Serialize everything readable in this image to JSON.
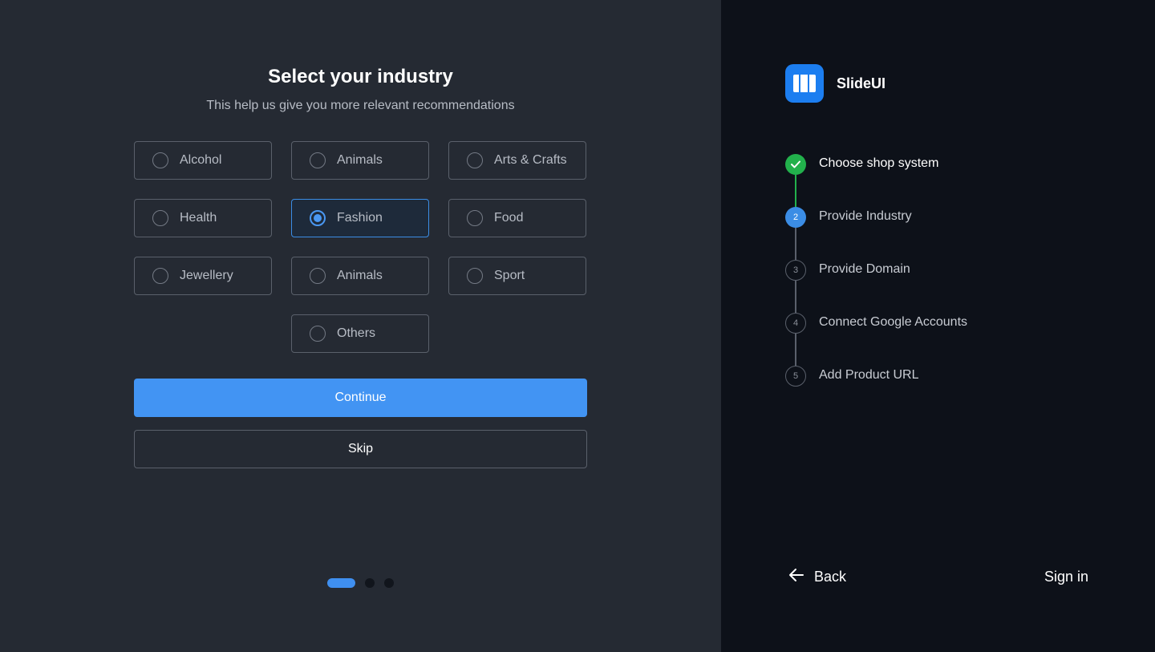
{
  "main": {
    "title": "Select your industry",
    "subtitle": "This help us give you more relevant recommendations",
    "options": [
      {
        "label": "Alcohol",
        "selected": false
      },
      {
        "label": "Animals",
        "selected": false
      },
      {
        "label": "Arts & Crafts",
        "selected": false
      },
      {
        "label": "Health",
        "selected": false
      },
      {
        "label": "Fashion",
        "selected": true
      },
      {
        "label": "Food",
        "selected": false
      },
      {
        "label": "Jewellery",
        "selected": false
      },
      {
        "label": "Animals",
        "selected": false
      },
      {
        "label": "Sport",
        "selected": false
      },
      {
        "label": "Others",
        "selected": false
      }
    ],
    "continue_label": "Continue",
    "skip_label": "Skip",
    "pager": {
      "current": 1,
      "total": 3
    }
  },
  "sidebar": {
    "brand": "SlideUI",
    "steps": [
      {
        "number": "1",
        "label": "Choose shop system",
        "status": "done"
      },
      {
        "number": "2",
        "label": "Provide Industry",
        "status": "current"
      },
      {
        "number": "3",
        "label": "Provide Domain",
        "status": "pending"
      },
      {
        "number": "4",
        "label": "Connect Google Accounts",
        "status": "pending"
      },
      {
        "number": "5",
        "label": "Add Product URL",
        "status": "pending"
      }
    ],
    "back_label": "Back",
    "signin_label": "Sign in"
  },
  "icons": {
    "logo": "slides-logo-icon",
    "back": "arrow-left-icon",
    "step_done": "check-icon"
  },
  "colors": {
    "accent": "#4294f3",
    "success": "#22b14c",
    "left_bg": "#252a33",
    "right_bg": "#0d1119"
  }
}
